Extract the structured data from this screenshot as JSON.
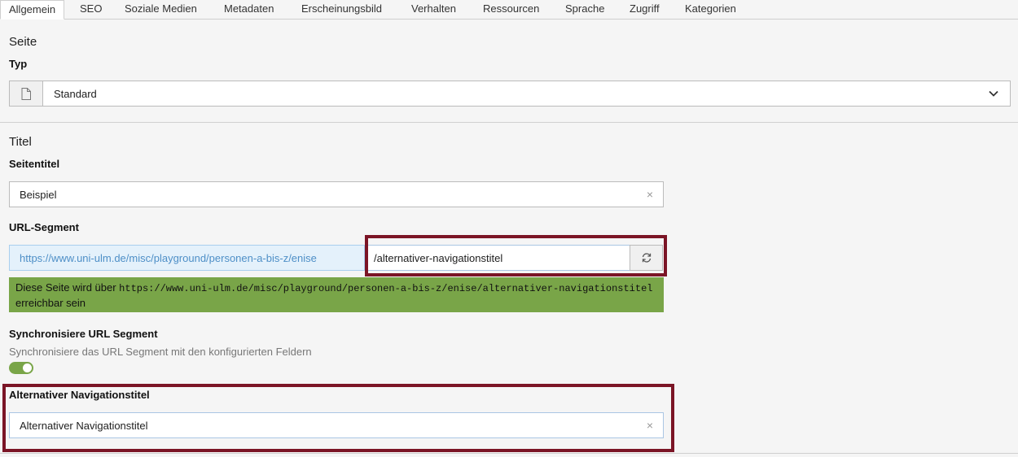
{
  "tabs": [
    {
      "label": "Allgemein",
      "active": true
    },
    {
      "label": "SEO"
    },
    {
      "label": "Soziale Medien"
    },
    {
      "label": "Metadaten"
    },
    {
      "label": "Erscheinungsbild"
    },
    {
      "label": "Verhalten"
    },
    {
      "label": "Ressourcen"
    },
    {
      "label": "Sprache"
    },
    {
      "label": "Zugriff"
    },
    {
      "label": "Kategorien"
    }
  ],
  "sections": {
    "seite": {
      "title": "Seite",
      "typ_label": "Typ",
      "typ_value": "Standard",
      "typ_icon": "page-icon"
    },
    "titel": {
      "title": "Titel",
      "seitentitel_label": "Seitentitel",
      "seitentitel_value": "Beispiel",
      "url_segment_label": "URL-Segment",
      "url_prefix": "https://www.uni-ulm.de/misc/playground/personen-a-bis-z/enise",
      "url_segment_value": "/alternativer-navigationstitel",
      "url_info_prefix": "Diese Seite wird über ",
      "url_info_code": "https://www.uni-ulm.de/misc/playground/personen-a-bis-z/enise/alternativer-navigationstitel",
      "url_info_suffix": "erreichbar sein",
      "sync_label": "Synchronisiere URL Segment",
      "sync_description": "Synchronisiere das URL Segment mit den konfigurierten Feldern",
      "sync_enabled": true,
      "nav_title_label": "Alternativer Navigationstitel",
      "nav_title_value": "Alternativer Navigationstitel"
    }
  },
  "icons": {
    "clear": "×"
  },
  "colors": {
    "highlight": "#7b1526",
    "success": "#79a548",
    "url_prefix_bg": "#e4f1fb",
    "url_prefix_text": "#4e8fc7"
  }
}
